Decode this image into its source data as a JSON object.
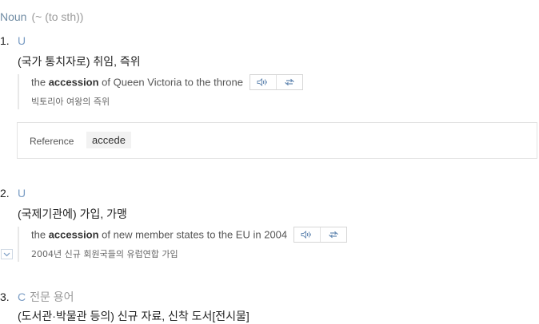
{
  "pos": {
    "name": "Noun",
    "pattern": "(~ (to sth))"
  },
  "senses": [
    {
      "number": "1.",
      "grammar": "U",
      "domain": "",
      "definition": "(국가 통치자로) 취임, 즉위",
      "example": {
        "before": "the ",
        "keyword": "accession",
        "after": " of Queen Victoria to the throne",
        "translation": "빅토리아 여왕의 즉위"
      }
    },
    {
      "number": "2.",
      "grammar": "U",
      "domain": "",
      "definition": "(국제기관에) 가입, 가맹",
      "example": {
        "before": "the ",
        "keyword": "accession",
        "after": " of new member states to the EU in 2004",
        "translation": "2004년 신규 회원국들의 유럽연합 가입"
      }
    },
    {
      "number": "3.",
      "grammar": "C",
      "domain": "전문 용어",
      "definition": "(도서관·박물관 등의) 신규 자료, 신착 도서[전시물]"
    }
  ],
  "reference": {
    "label": "Reference",
    "word": "accede"
  },
  "icons": {
    "listen": "speaker-waves-icon",
    "repeat": "repeat-icon",
    "expand": "chevron-down-icon"
  },
  "colors": {
    "pos": "#6f8ba3",
    "grammar": "#7a9cc4",
    "muted": "#999999"
  }
}
